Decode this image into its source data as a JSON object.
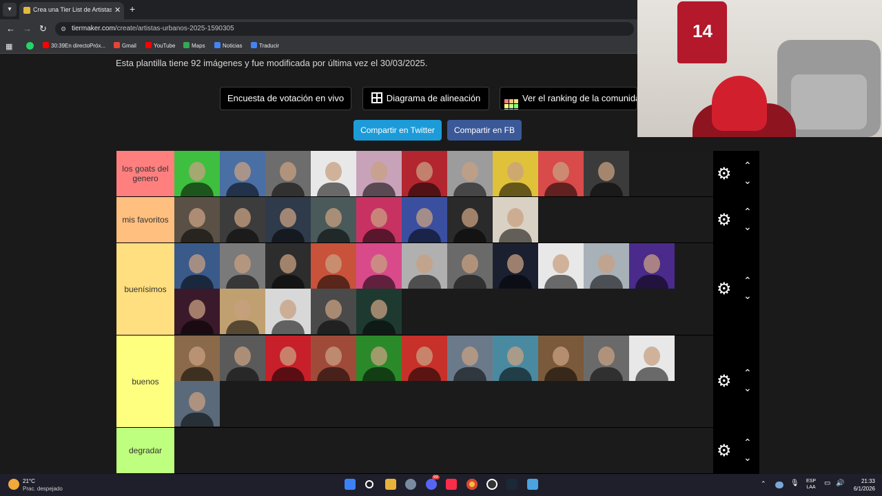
{
  "browser": {
    "tab_title": "Crea una Tier List de Artistas Ur",
    "tab_close": "✕",
    "new_tab": "+",
    "url_host": "tiermaker.com",
    "url_path": "/create/artistas-urbanos-2025-1590305",
    "bookmarks": [
      {
        "label": "30:39En directoPróx...",
        "icon_color": "#ff0000"
      },
      {
        "label": "Gmail",
        "icon_color": "#ea4335"
      },
      {
        "label": "YouTube",
        "icon_color": "#ff0000"
      },
      {
        "label": "Maps",
        "icon_color": "#34a853"
      },
      {
        "label": "Noticias",
        "icon_color": "#4285f4"
      },
      {
        "label": "Traducir",
        "icon_color": "#4285f4"
      }
    ]
  },
  "page": {
    "info_text": "Esta plantilla tiene 92 imágenes y fue modificada por última vez el 30/03/2025.",
    "buttons": {
      "poll": "Encuesta de votación en vivo",
      "alignment": "Diagrama de alineación",
      "ranking": "Ver el ranking de la comunidad",
      "twitter": "Compartir en Twitter",
      "facebook": "Compartir en FB"
    },
    "colors": {
      "twitter": "#1d9bd9",
      "facebook": "#3b5998"
    }
  },
  "tiers": [
    {
      "label": "los goats del genero",
      "color": "#ff7f7f",
      "count": 10,
      "palette": [
        "#3fbf3f",
        "#4a6fa5",
        "#6d6d6d",
        "#e8e8e8",
        "#c8a2b8",
        "#b32630",
        "#9c9c9c",
        "#e0c23a",
        "#d94a4a",
        "#3b3b3b"
      ]
    },
    {
      "label": "mis favoritos",
      "color": "#ffbf7f",
      "count": 8,
      "palette": [
        "#5a5045",
        "#3c3c3c",
        "#2f3a4a",
        "#4a5a5a",
        "#c83262",
        "#3a4fa0",
        "#2a2a2a",
        "#d9d2c4"
      ]
    },
    {
      "label": "buenísimos",
      "color": "#ffdf7f",
      "count": 16,
      "palette": [
        "#3a5a8a",
        "#7a7a7a",
        "#2d2d2d",
        "#c8523a",
        "#d84a8a",
        "#b0b0b0",
        "#6a6a6a",
        "#1a2030",
        "#e8e8e8",
        "#a8b0b8",
        "#4a2a8a",
        "#3a1a2a",
        "#c0a070",
        "#d8d8d8",
        "#4a4a4a",
        "#1e3a30"
      ]
    },
    {
      "label": "buenos",
      "color": "#ffff7f",
      "count": 12,
      "palette": [
        "#8a6a4a",
        "#5a5a5a",
        "#c8202a",
        "#a04a3a",
        "#2a8a2a",
        "#c8302a",
        "#6a7a8a",
        "#4a8aa0",
        "#7a5a3a",
        "#6a6a6a",
        "#e8e8e8",
        "#5a6a7a"
      ]
    },
    {
      "label": "degradar",
      "color": "#bfff7f",
      "count": 0,
      "palette": []
    }
  ],
  "webcam": {
    "jersey_text": "14"
  },
  "taskbar": {
    "temp": "21°C",
    "condition": "Prac. despejado",
    "lang_line1": "ESP",
    "lang_line2": "LAA",
    "time": "21:33",
    "date": "6/1/2026",
    "badge": "99"
  }
}
